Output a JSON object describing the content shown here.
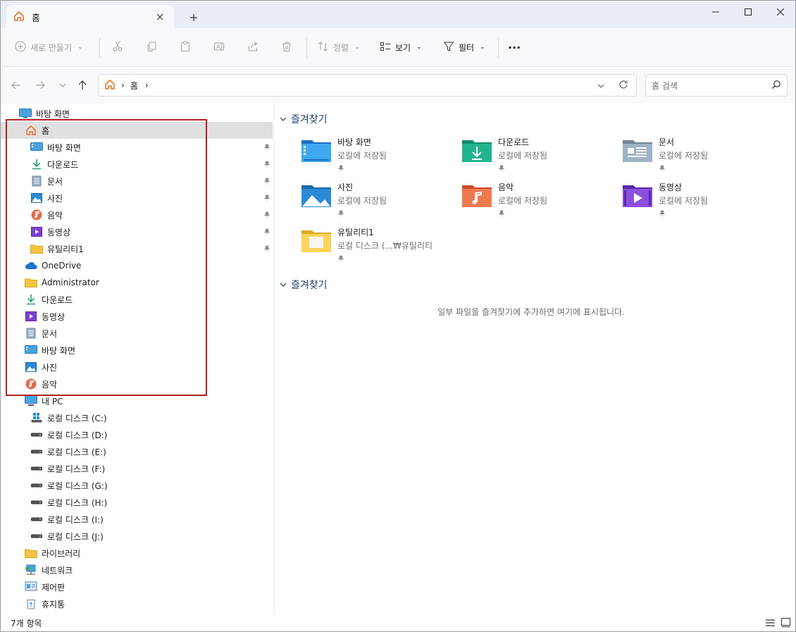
{
  "tab": {
    "title": "홈"
  },
  "toolbar": {
    "new_label": "새로 만들기",
    "sort_label": "정렬",
    "view_label": "보기",
    "filter_label": "필터",
    "more_label": "···"
  },
  "address": {
    "crumbs": [
      "홈"
    ],
    "search_placeholder": "홈 검색"
  },
  "nav": {
    "desktop_root": "바탕 화면",
    "home": "홈",
    "pinned": [
      {
        "label": "바탕 화면",
        "icon": "desktop-icon"
      },
      {
        "label": "다운로드",
        "icon": "download-icon"
      },
      {
        "label": "문서",
        "icon": "document-icon"
      },
      {
        "label": "사진",
        "icon": "pictures-icon"
      },
      {
        "label": "음악",
        "icon": "music-icon"
      },
      {
        "label": "동영상",
        "icon": "video-icon"
      },
      {
        "label": "유틸리티1",
        "icon": "folder-icon"
      }
    ],
    "onedrive": "OneDrive",
    "user_items": [
      {
        "label": "Administrator",
        "icon": "folder-icon"
      },
      {
        "label": "다운로드",
        "icon": "download-icon"
      },
      {
        "label": "동영상",
        "icon": "video-icon"
      },
      {
        "label": "문서",
        "icon": "document-icon"
      },
      {
        "label": "바탕 화면",
        "icon": "desktop-icon"
      },
      {
        "label": "사진",
        "icon": "pictures-icon"
      },
      {
        "label": "음악",
        "icon": "music-icon"
      }
    ],
    "this_pc": "내 PC",
    "drives": [
      "로컬 디스크 (C:)",
      "로컬 디스크 (D:)",
      "로컬 디스크 (E:)",
      "로컬 디스크 (F:)",
      "로컬 디스크 (G:)",
      "로컬 디스크 (H:)",
      "로컬 디스크 (I:)",
      "로컬 디스크 (J:)"
    ],
    "libraries": "라이브러리",
    "network": "네트워크",
    "control_panel": "제어판",
    "recycle_bin": "휴지통"
  },
  "content": {
    "quick_access_title": "즐겨찾기",
    "favorites_title": "즐겨찾기",
    "tiles": [
      {
        "name": "바탕 화면",
        "sub": "로컬에 저장됨",
        "icon": "desktop-folder-icon"
      },
      {
        "name": "다운로드",
        "sub": "로컬에 저장됨",
        "icon": "download-folder-icon"
      },
      {
        "name": "문서",
        "sub": "로컬에 저장됨",
        "icon": "document-folder-icon"
      },
      {
        "name": "사진",
        "sub": "로컬에 저장됨",
        "icon": "pictures-folder-icon"
      },
      {
        "name": "음악",
        "sub": "로컬에 저장됨",
        "icon": "music-folder-icon"
      },
      {
        "name": "동영상",
        "sub": "로컬에 저장됨",
        "icon": "video-folder-icon"
      },
      {
        "name": "유틸리티1",
        "sub": "로컬 디스크 (...₩유틸리티",
        "icon": "folder-icon"
      }
    ],
    "empty_message": "일부 파일을 즐겨찾기에 추가하면 여기에 표시됩니다."
  },
  "status": {
    "item_count": "7개 항목"
  },
  "colors": {
    "highlight": "#b22222",
    "selected": "#e0e0e0",
    "accent": "#0067c0"
  }
}
